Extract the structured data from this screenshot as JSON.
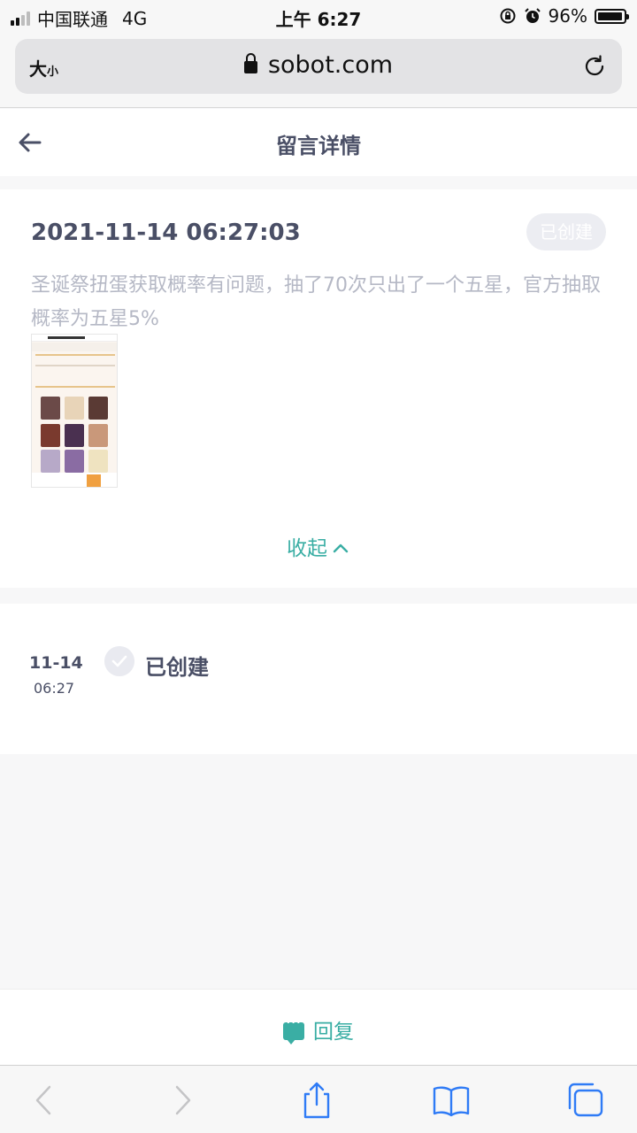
{
  "status_bar": {
    "carrier": "中国联通",
    "network": "4G",
    "time": "上午 6:27",
    "battery": "96%",
    "battery_level": 0.96,
    "signal_bars": 2,
    "icons": [
      "orientation-lock-icon",
      "alarm-icon",
      "battery-icon"
    ]
  },
  "browser": {
    "text_size_label": "大",
    "text_size_small": "小",
    "domain": "sobot.com",
    "icons": [
      "lock-icon",
      "reload-icon"
    ]
  },
  "header": {
    "title": "留言详情",
    "back_icon": "back-arrow-icon"
  },
  "ticket": {
    "datetime": "2021-11-14 06:27:03",
    "status": "已创建",
    "content": "圣诞祭扭蛋获取概率有问题，抽了70次只出了一个五星，官方抽取概率为五星5%",
    "collapse_label": "收起"
  },
  "timeline": [
    {
      "date": "11-14",
      "time": "06:27",
      "status": "已创建"
    }
  ],
  "reply": {
    "label": "回复"
  },
  "colors": {
    "accent": "#3aaea4",
    "title_text": "#4a4f66",
    "muted_text": "#b5b8c5",
    "badge_bg": "#ecedf2"
  }
}
